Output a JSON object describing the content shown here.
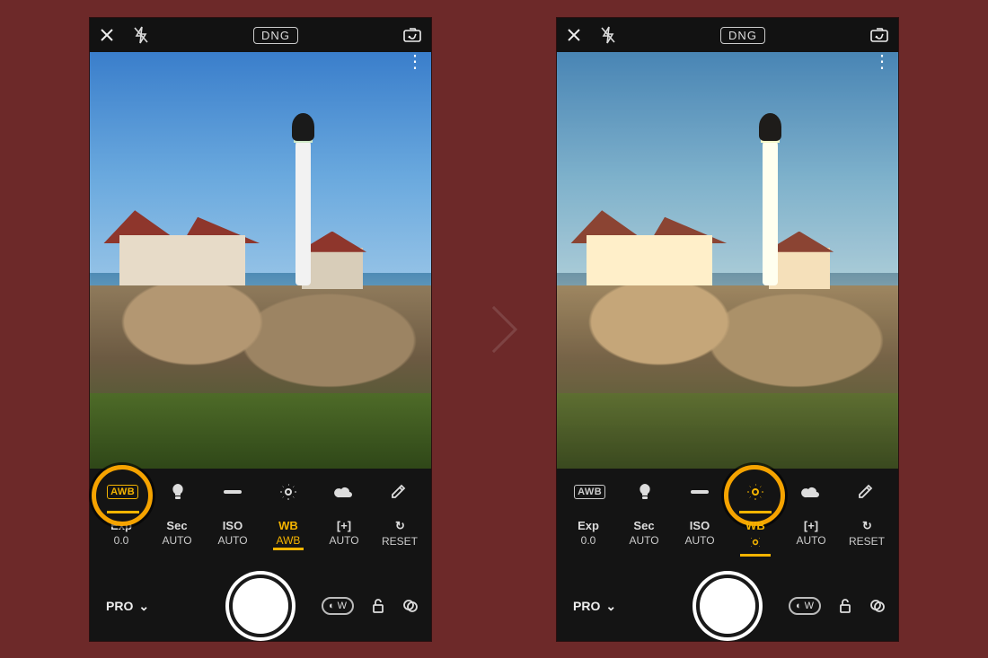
{
  "topbar": {
    "format_label": "DNG"
  },
  "wb": {
    "awb_label": "AWB"
  },
  "pro": {
    "exp": {
      "label": "Exp",
      "value": "0.0"
    },
    "sec": {
      "label": "Sec",
      "value": "AUTO"
    },
    "iso": {
      "label": "ISO",
      "value": "AUTO"
    },
    "wb": {
      "label": "WB",
      "value_awb": "AWB"
    },
    "focus": {
      "label": "[+]",
      "value": "AUTO"
    },
    "reset": {
      "label": "RESET"
    }
  },
  "bottom": {
    "mode_label": "PRO",
    "wide_label": "W"
  },
  "arrow": {
    "direction": "right"
  }
}
